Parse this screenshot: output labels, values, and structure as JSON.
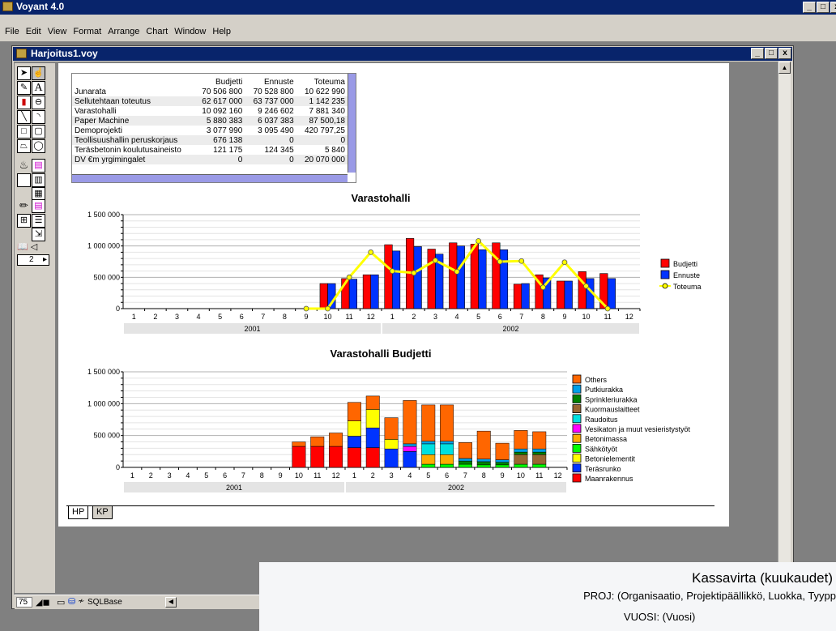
{
  "app": {
    "title": "Voyant 4.0"
  },
  "menu": [
    "File",
    "Edit",
    "View",
    "Format",
    "Arrange",
    "Chart",
    "Window",
    "Help"
  ],
  "document": {
    "title": "Harjoitus1.voy"
  },
  "toolbar": {
    "page_value": "2"
  },
  "table": {
    "headers": [
      "",
      "Budjetti",
      "Ennuste",
      "Toteuma"
    ],
    "rows": [
      [
        "Junarata",
        "70 506 800",
        "70 528 800",
        "10 622 990"
      ],
      [
        "Sellutehtaan toteutus",
        "62 617 000",
        "63 737 000",
        "1 142 235"
      ],
      [
        "Varastohalli",
        "10 092 160",
        "9 246 602",
        "7 881 340"
      ],
      [
        "Paper Machine",
        "5 880 383",
        "6 037 383",
        "87 500,18"
      ],
      [
        "Demoprojekti",
        "3 077 990",
        "3 095 490",
        "420 797,25"
      ],
      [
        "Teollisuushallin peruskorjaus",
        "676 138",
        "0",
        "0"
      ],
      [
        "Teräsbetonin koulutusaineisto",
        "121 175",
        "124 345",
        "5 840"
      ],
      [
        "DV €m yrgimingalet",
        "0",
        "0",
        "20 070 000"
      ]
    ]
  },
  "chart_data": [
    {
      "type": "bar",
      "title": "Varastohalli",
      "categories": [
        "1",
        "2",
        "3",
        "4",
        "5",
        "6",
        "7",
        "8",
        "9",
        "10",
        "11",
        "12",
        "1",
        "2",
        "3",
        "4",
        "5",
        "6",
        "7",
        "8",
        "9",
        "10",
        "11",
        "12"
      ],
      "groups": [
        "2001",
        "2002"
      ],
      "y_ticks": [
        "0",
        "500 000",
        "1 000 000",
        "1 500 000"
      ],
      "ylim": [
        0,
        1500000
      ],
      "legend_position": "right",
      "series": [
        {
          "name": "Budjetti",
          "color": "#ff0000",
          "kind": "bar",
          "values": [
            0,
            0,
            0,
            0,
            0,
            0,
            0,
            0,
            0,
            400000,
            480000,
            540000,
            1020000,
            1120000,
            950000,
            1050000,
            1030000,
            1050000,
            390000,
            540000,
            440000,
            590000,
            560000,
            0
          ]
        },
        {
          "name": "Ennuste",
          "color": "#0033ff",
          "kind": "bar",
          "values": [
            0,
            0,
            0,
            0,
            0,
            0,
            0,
            0,
            0,
            400000,
            470000,
            540000,
            920000,
            990000,
            870000,
            1000000,
            940000,
            940000,
            400000,
            490000,
            440000,
            480000,
            480000,
            0
          ]
        },
        {
          "name": "Toteuma",
          "color": "#ffff00",
          "kind": "line",
          "values": [
            null,
            null,
            null,
            null,
            null,
            null,
            null,
            null,
            0,
            0,
            500000,
            900000,
            600000,
            570000,
            770000,
            590000,
            1080000,
            750000,
            760000,
            340000,
            740000,
            360000,
            0,
            null
          ]
        }
      ]
    },
    {
      "type": "stacked-bar",
      "title": "Varastohalli Budjetti",
      "categories": [
        "1",
        "2",
        "3",
        "4",
        "5",
        "6",
        "7",
        "8",
        "9",
        "10",
        "11",
        "12",
        "1",
        "2",
        "3",
        "4",
        "5",
        "6",
        "7",
        "8",
        "9",
        "10",
        "11",
        "12"
      ],
      "groups": [
        "2001",
        "2002"
      ],
      "y_ticks": [
        "0",
        "500 000",
        "1 000 000",
        "1 500 000"
      ],
      "ylim": [
        0,
        1500000
      ],
      "legend_position": "right",
      "series": [
        {
          "name": "Maanrakennus",
          "color": "#ff0000",
          "values": [
            0,
            0,
            0,
            0,
            0,
            0,
            0,
            0,
            0,
            330000,
            330000,
            330000,
            310000,
            310000,
            0,
            0,
            0,
            0,
            0,
            0,
            0,
            0,
            0,
            0
          ]
        },
        {
          "name": "Teräsrunko",
          "color": "#0033ff",
          "values": [
            0,
            0,
            0,
            0,
            0,
            0,
            0,
            0,
            0,
            0,
            0,
            0,
            180000,
            310000,
            290000,
            250000,
            0,
            0,
            0,
            0,
            0,
            0,
            0,
            0
          ]
        },
        {
          "name": "Betonielementit",
          "color": "#ffff00",
          "values": [
            0,
            0,
            0,
            0,
            0,
            0,
            0,
            0,
            0,
            0,
            0,
            0,
            240000,
            290000,
            150000,
            0,
            0,
            0,
            0,
            0,
            0,
            0,
            0,
            0
          ]
        },
        {
          "name": "Sähkötyöt",
          "color": "#00ff00",
          "values": [
            0,
            0,
            0,
            0,
            0,
            0,
            0,
            0,
            0,
            0,
            0,
            0,
            0,
            0,
            0,
            0,
            50000,
            50000,
            50000,
            40000,
            40000,
            50000,
            50000,
            0
          ]
        },
        {
          "name": "Betonimassa",
          "color": "#ffaa00",
          "values": [
            0,
            0,
            0,
            0,
            0,
            0,
            0,
            0,
            0,
            0,
            0,
            0,
            0,
            0,
            0,
            0,
            150000,
            150000,
            0,
            0,
            0,
            0,
            0,
            0
          ]
        },
        {
          "name": "Vesikaton ja muut vesieristystyöt",
          "color": "#ff00ff",
          "values": [
            0,
            0,
            0,
            0,
            0,
            0,
            0,
            0,
            0,
            0,
            0,
            0,
            0,
            0,
            0,
            80000,
            0,
            0,
            0,
            0,
            0,
            0,
            0,
            0
          ]
        },
        {
          "name": "Raudoitus",
          "color": "#00e0e0",
          "values": [
            0,
            0,
            0,
            0,
            0,
            0,
            0,
            0,
            0,
            0,
            0,
            0,
            0,
            0,
            0,
            0,
            170000,
            170000,
            0,
            0,
            0,
            0,
            0,
            0
          ]
        },
        {
          "name": "Kuormauslaitteet",
          "color": "#996633",
          "values": [
            0,
            0,
            0,
            0,
            0,
            0,
            0,
            0,
            0,
            0,
            0,
            0,
            0,
            0,
            0,
            0,
            0,
            0,
            0,
            0,
            0,
            150000,
            150000,
            0
          ]
        },
        {
          "name": "Sprinkleriurakka",
          "color": "#008000",
          "values": [
            0,
            0,
            0,
            0,
            0,
            0,
            0,
            0,
            0,
            0,
            0,
            0,
            0,
            0,
            0,
            0,
            0,
            0,
            50000,
            50000,
            40000,
            40000,
            40000,
            0
          ]
        },
        {
          "name": "Putkiurakka",
          "color": "#00a0e8",
          "values": [
            0,
            0,
            0,
            0,
            0,
            0,
            0,
            0,
            0,
            0,
            0,
            0,
            0,
            0,
            0,
            40000,
            40000,
            40000,
            40000,
            40000,
            40000,
            50000,
            50000,
            0
          ]
        },
        {
          "name": "Others",
          "color": "#ff6600",
          "values": [
            0,
            0,
            0,
            0,
            0,
            0,
            0,
            0,
            0,
            70000,
            150000,
            210000,
            290000,
            210000,
            340000,
            680000,
            570000,
            570000,
            250000,
            440000,
            260000,
            290000,
            270000,
            0
          ]
        }
      ]
    }
  ],
  "tabs": [
    "HP",
    "KP"
  ],
  "status": {
    "zoom": "75",
    "db": "SQLBase"
  },
  "popup": {
    "title": "Kassavirta (kuukaudet)",
    "line1": "PROJ: (Organisaatio, Projektipäällikkö, Luokka, Tyypp",
    "line2": "VUOSI: (Vuosi)"
  }
}
